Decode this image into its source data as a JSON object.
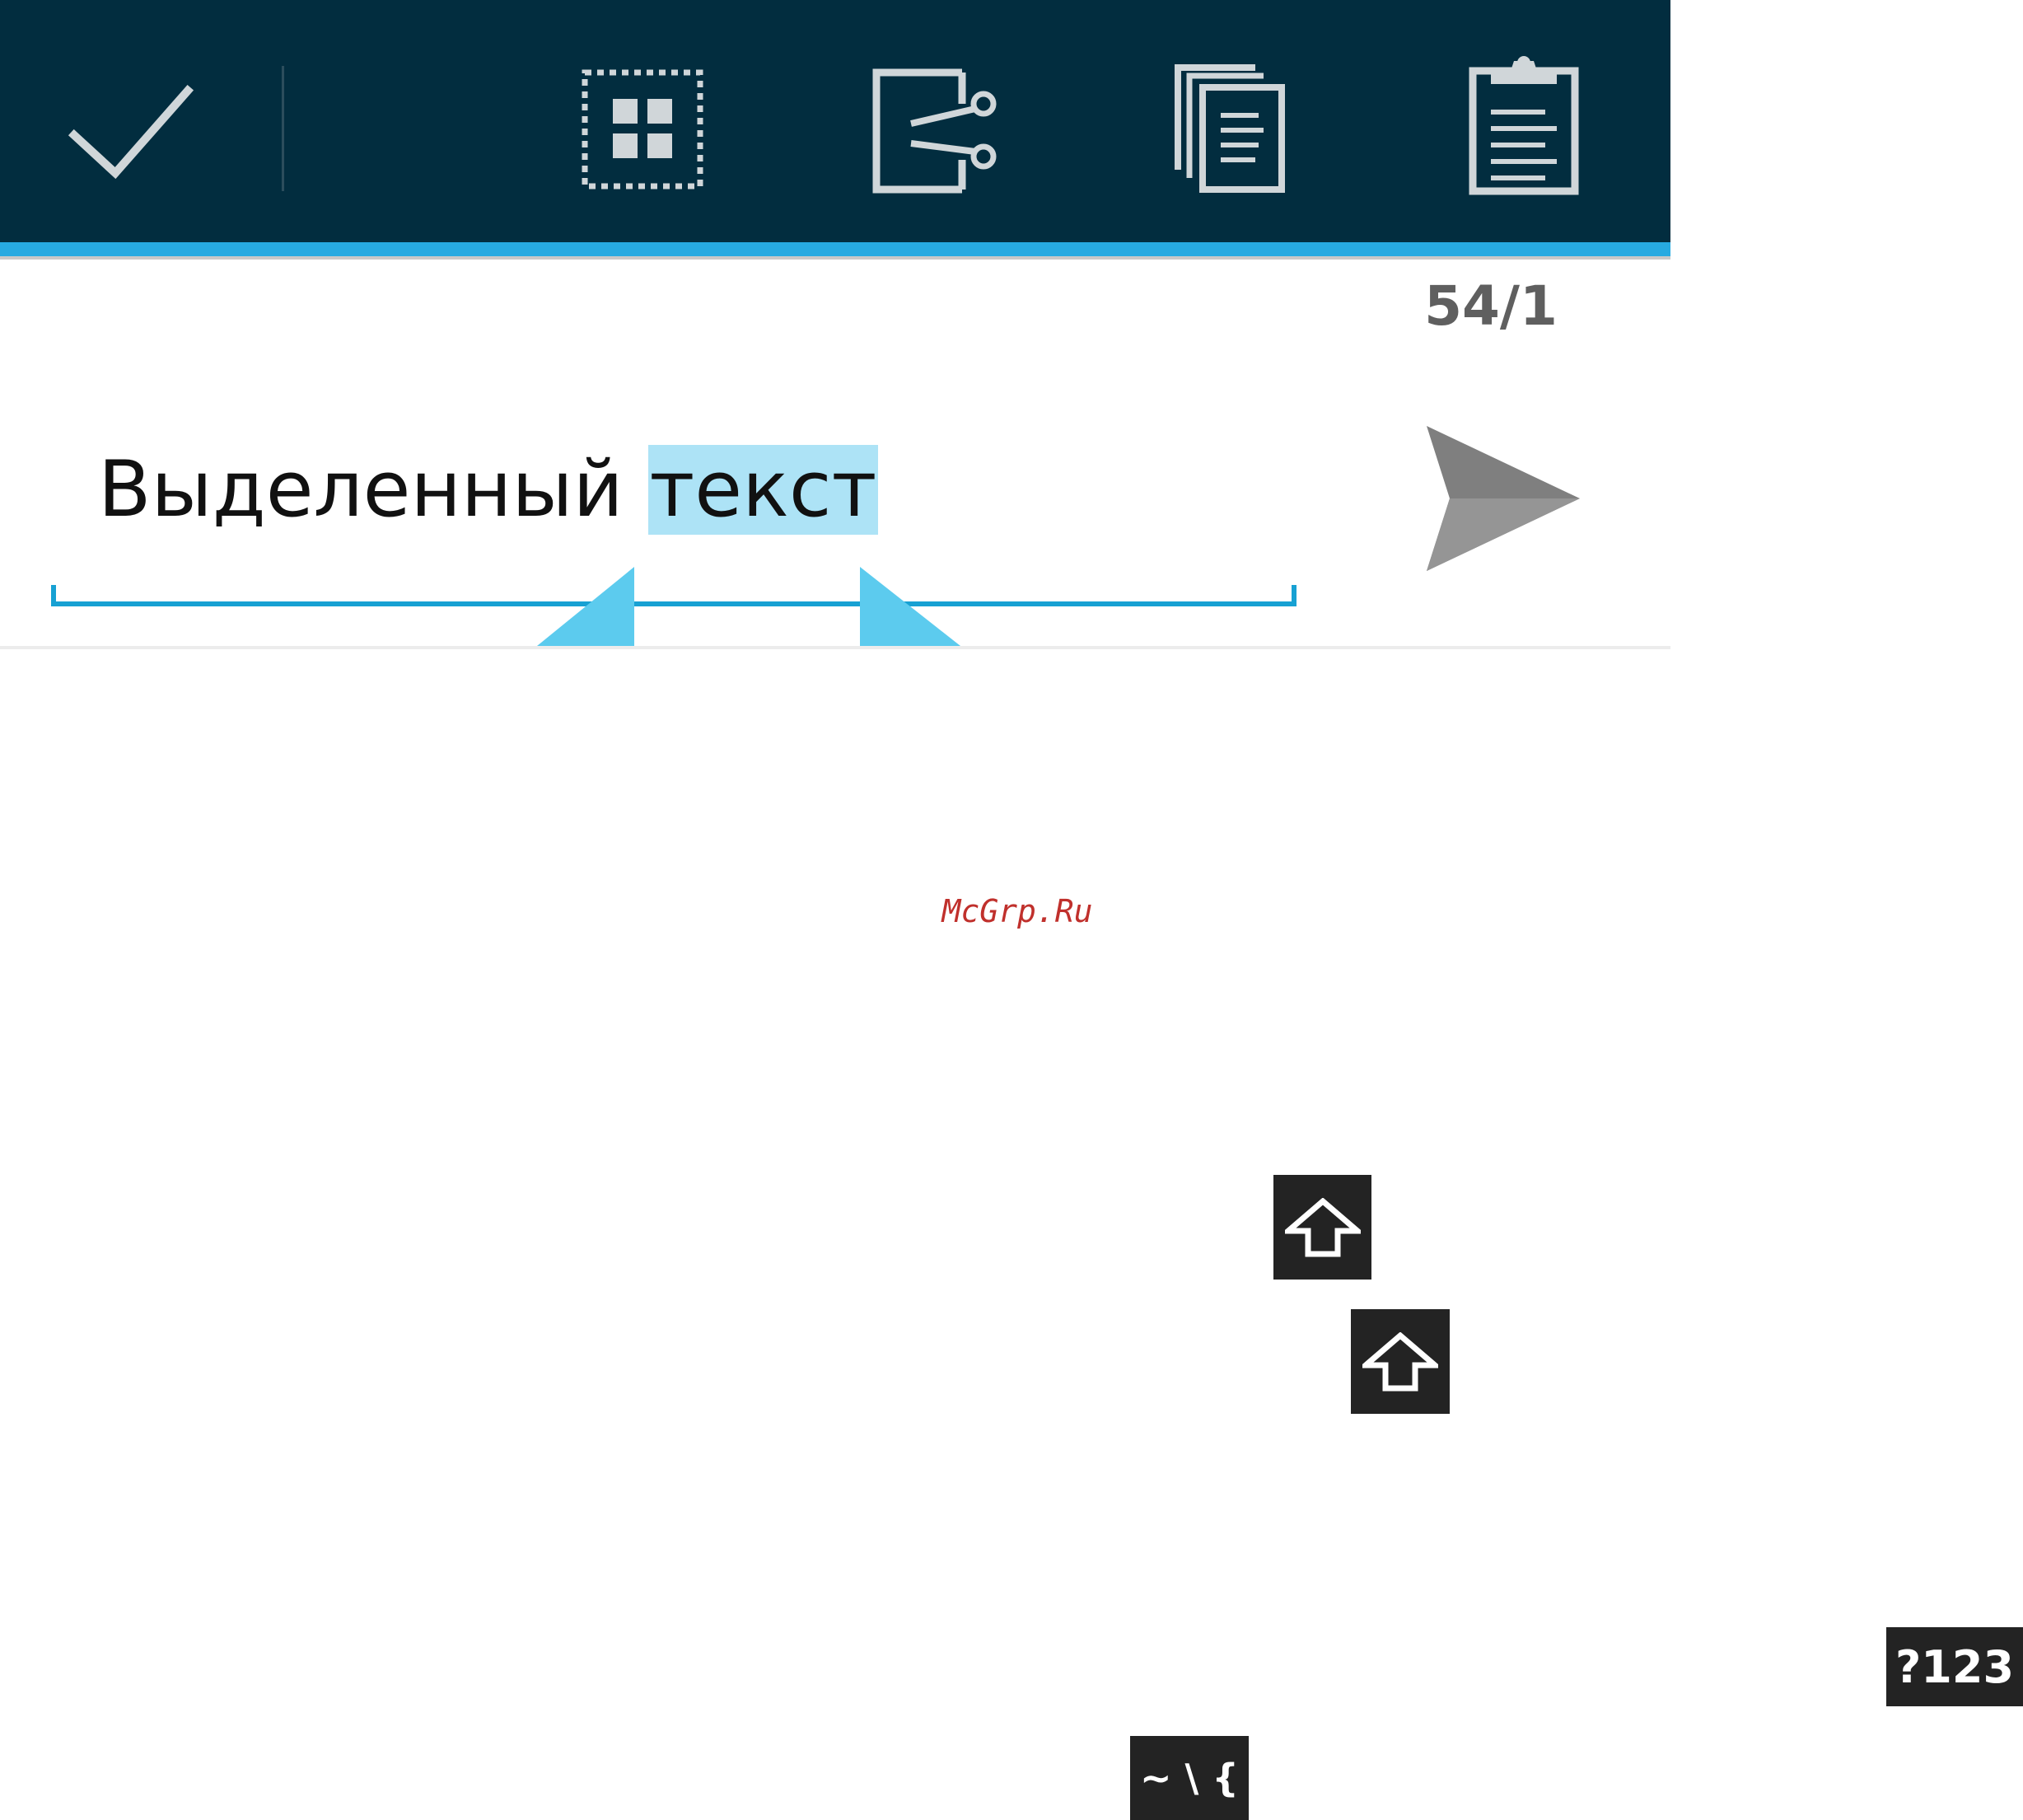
{
  "action_bar": {
    "accent_color": "#27aae1",
    "background_color": "#022d3f",
    "actions": [
      {
        "icon": "checkmark-icon",
        "meaning": "done"
      },
      {
        "icon": "select-all-icon",
        "meaning": "select all"
      },
      {
        "icon": "cut-icon",
        "meaning": "cut"
      },
      {
        "icon": "copy-icon",
        "meaning": "copy"
      },
      {
        "icon": "paste-icon",
        "meaning": "paste"
      }
    ]
  },
  "counter": "54/1",
  "text_field": {
    "plain_text": "Выделенный ",
    "selected_text": "текст",
    "selection_color": "#ade3f6",
    "underline_color": "#17a1d3"
  },
  "send_button": {
    "icon": "send-icon"
  },
  "watermark": "McGrp.Ru",
  "keys": {
    "shift_icon": "shift-arrow-icon",
    "symbols_label": "?123",
    "misc_label": "~ \\ {"
  }
}
